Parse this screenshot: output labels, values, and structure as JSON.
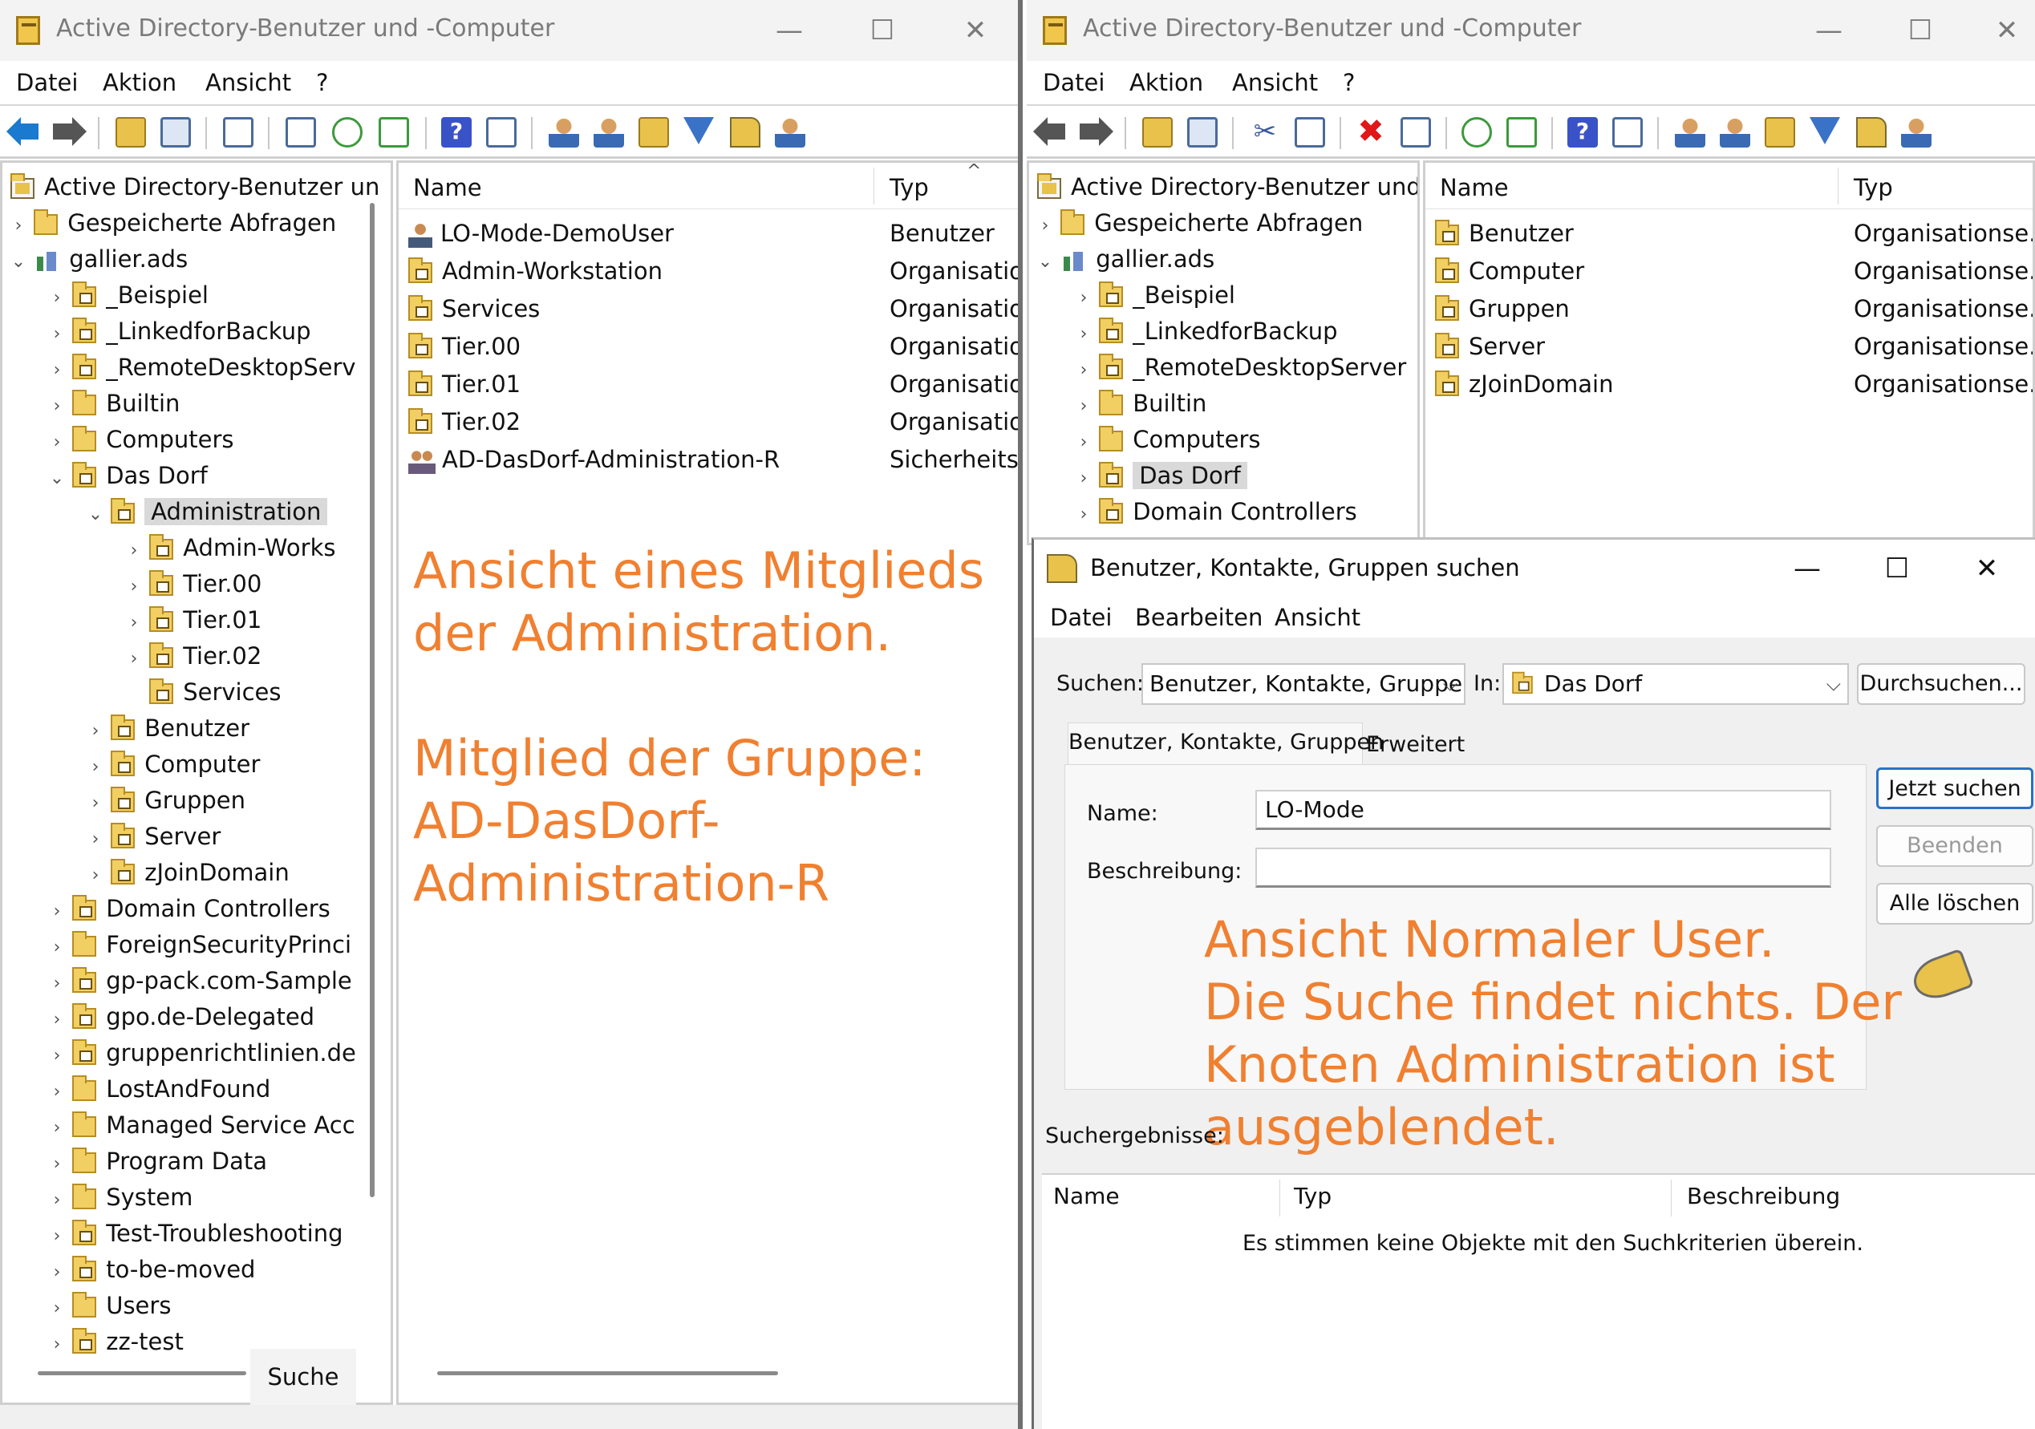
{
  "left": {
    "title": "Active Directory-Benutzer und -Computer",
    "menu": [
      "Datei",
      "Aktion",
      "Ansicht",
      "?"
    ],
    "tree": {
      "root": "Active Directory-Benutzer un",
      "saved": "Gespeicherte Abfragen",
      "domain": "gallier.ads",
      "items": [
        {
          "label": "_Beispiel",
          "indent": 1,
          "icon": "ou",
          "chev": ">"
        },
        {
          "label": "_LinkedforBackup",
          "indent": 1,
          "icon": "ou",
          "chev": ">"
        },
        {
          "label": "_RemoteDesktopServ",
          "indent": 1,
          "icon": "ou",
          "chev": ">"
        },
        {
          "label": "Builtin",
          "indent": 1,
          "icon": "folder",
          "chev": ">"
        },
        {
          "label": "Computers",
          "indent": 1,
          "icon": "folder",
          "chev": ">"
        },
        {
          "label": "Das Dorf",
          "indent": 1,
          "icon": "ou",
          "chev": "v"
        },
        {
          "label": "Administration",
          "indent": 2,
          "icon": "ou",
          "chev": "v",
          "selected": true
        },
        {
          "label": "Admin-Works",
          "indent": 3,
          "icon": "ou",
          "chev": ">"
        },
        {
          "label": "Tier.00",
          "indent": 3,
          "icon": "ou",
          "chev": ">"
        },
        {
          "label": "Tier.01",
          "indent": 3,
          "icon": "ou",
          "chev": ">"
        },
        {
          "label": "Tier.02",
          "indent": 3,
          "icon": "ou",
          "chev": ">"
        },
        {
          "label": "Services",
          "indent": 3,
          "icon": "ou",
          "chev": ""
        },
        {
          "label": "Benutzer",
          "indent": 2,
          "icon": "ou",
          "chev": ">"
        },
        {
          "label": "Computer",
          "indent": 2,
          "icon": "ou",
          "chev": ">"
        },
        {
          "label": "Gruppen",
          "indent": 2,
          "icon": "ou",
          "chev": ">"
        },
        {
          "label": "Server",
          "indent": 2,
          "icon": "ou",
          "chev": ">"
        },
        {
          "label": "zJoinDomain",
          "indent": 2,
          "icon": "ou",
          "chev": ">"
        },
        {
          "label": "Domain Controllers",
          "indent": 1,
          "icon": "ou",
          "chev": ">"
        },
        {
          "label": "ForeignSecurityPrinci",
          "indent": 1,
          "icon": "folder",
          "chev": ">"
        },
        {
          "label": "gp-pack.com-Sample",
          "indent": 1,
          "icon": "ou",
          "chev": ">"
        },
        {
          "label": "gpo.de-Delegated",
          "indent": 1,
          "icon": "ou",
          "chev": ">"
        },
        {
          "label": "gruppenrichtlinien.de",
          "indent": 1,
          "icon": "ou",
          "chev": ">"
        },
        {
          "label": "LostAndFound",
          "indent": 1,
          "icon": "folder",
          "chev": ">"
        },
        {
          "label": "Managed Service Acc",
          "indent": 1,
          "icon": "folder",
          "chev": ">"
        },
        {
          "label": "Program Data",
          "indent": 1,
          "icon": "folder",
          "chev": ">"
        },
        {
          "label": "System",
          "indent": 1,
          "icon": "folder",
          "chev": ">"
        },
        {
          "label": "Test-Troubleshooting",
          "indent": 1,
          "icon": "ou",
          "chev": ">"
        },
        {
          "label": "to-be-moved",
          "indent": 1,
          "icon": "ou",
          "chev": ">"
        },
        {
          "label": "Users",
          "indent": 1,
          "icon": "folder",
          "chev": ">"
        },
        {
          "label": "zz-test",
          "indent": 1,
          "icon": "ou",
          "chev": ">"
        }
      ]
    },
    "list": {
      "col_name": "Name",
      "col_type": "Typ",
      "rows": [
        {
          "name": "LO-Mode-DemoUser",
          "type": "Benutzer",
          "icon": "user"
        },
        {
          "name": "Admin-Workstation",
          "type": "Organisation",
          "icon": "ou"
        },
        {
          "name": "Services",
          "type": "Organisation",
          "icon": "ou"
        },
        {
          "name": "Tier.00",
          "type": "Organisation",
          "icon": "ou"
        },
        {
          "name": "Tier.01",
          "type": "Organisation",
          "icon": "ou"
        },
        {
          "name": "Tier.02",
          "type": "Organisation",
          "icon": "ou"
        },
        {
          "name": "AD-DasDorf-Administration-R",
          "type": "Sicherheitsg",
          "icon": "group"
        }
      ]
    },
    "annotation": [
      "Ansicht eines Mitglieds",
      "der Administration.",
      "",
      "Mitglied der Gruppe:",
      "AD-DasDorf-",
      "Administration-R"
    ],
    "suche_tab": "Suche"
  },
  "right": {
    "title": "Active Directory-Benutzer und -Computer",
    "menu": [
      "Datei",
      "Aktion",
      "Ansicht",
      "?"
    ],
    "tree": {
      "root": "Active Directory-Benutzer und -",
      "saved": "Gespeicherte Abfragen",
      "domain": "gallier.ads",
      "items": [
        {
          "label": "_Beispiel",
          "icon": "ou"
        },
        {
          "label": "_LinkedforBackup",
          "icon": "ou"
        },
        {
          "label": "_RemoteDesktopServer",
          "icon": "ou"
        },
        {
          "label": "Builtin",
          "icon": "folder"
        },
        {
          "label": "Computers",
          "icon": "folder"
        },
        {
          "label": "Das Dorf",
          "icon": "ou",
          "selected": true
        },
        {
          "label": "Domain Controllers",
          "icon": "ou"
        }
      ]
    },
    "list": {
      "col_name": "Name",
      "col_type": "Typ",
      "rows": [
        {
          "name": "Benutzer",
          "type": "Organisationse..."
        },
        {
          "name": "Computer",
          "type": "Organisationse..."
        },
        {
          "name": "Gruppen",
          "type": "Organisationse..."
        },
        {
          "name": "Server",
          "type": "Organisationse..."
        },
        {
          "name": "zJoinDomain",
          "type": "Organisationse..."
        }
      ]
    }
  },
  "dialog": {
    "title": "Benutzer, Kontakte, Gruppen suchen",
    "menu": [
      "Datei",
      "Bearbeiten",
      "Ansicht"
    ],
    "suchen_label": "Suchen:",
    "suchen_value": "Benutzer, Kontakte, Gruppen",
    "in_label": "In:",
    "in_value": "Das Dorf",
    "durchsuchen": "Durchsuchen...",
    "tab_main": "Benutzer, Kontakte, Gruppen",
    "tab_ext": "Erweitert",
    "name_label": "Name:",
    "name_value": "LO-Mode",
    "desc_label": "Beschreibung:",
    "desc_value": "",
    "btn_search": "Jetzt suchen",
    "btn_stop": "Beenden",
    "btn_clear": "Alle löschen",
    "results_label": "Suchergebnisse:",
    "col_name": "Name",
    "col_type": "Typ",
    "col_desc": "Beschreibung",
    "no_results": "Es stimmen keine Objekte mit den Suchkriterien überein.",
    "annotation": [
      "Ansicht Normaler User.",
      "Die Suche findet nichts. Der",
      "Knoten Administration ist",
      "ausgeblendet."
    ]
  },
  "colors": {
    "annotation": "#f08030",
    "selection": "#d9d9d9",
    "default_button": "#2a72c8"
  }
}
